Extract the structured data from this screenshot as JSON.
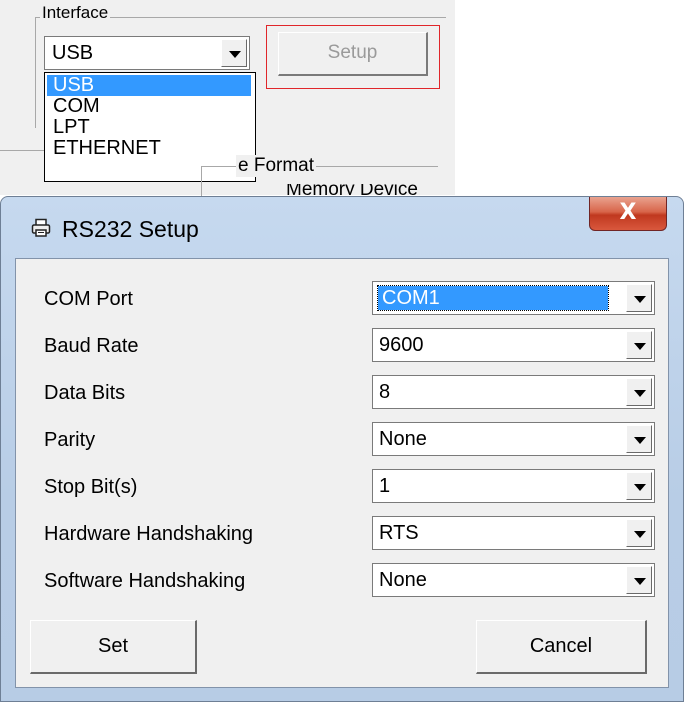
{
  "interface_panel": {
    "legend": "Interface",
    "selected": "USB",
    "options": [
      "USB",
      "COM",
      "LPT",
      "ETHERNET"
    ],
    "highlighted_option": "USB",
    "setup_button": "Setup",
    "format_legend": "e Format",
    "format_sub": "Memory Device",
    "highlight_box_color": "#e0262a"
  },
  "dialog": {
    "title": "RS232 Setup",
    "close_symbol": "X",
    "fields": [
      {
        "label": "COM Port",
        "value": "COM1"
      },
      {
        "label": "Baud Rate",
        "value": "9600"
      },
      {
        "label": "Data Bits",
        "value": "8"
      },
      {
        "label": "Parity",
        "value": "None"
      },
      {
        "label": "Stop Bit(s)",
        "value": "1"
      },
      {
        "label": "Hardware Handshaking",
        "value": "RTS"
      },
      {
        "label": "Software Handshaking",
        "value": "None"
      }
    ],
    "set_button": "Set",
    "cancel_button": "Cancel"
  },
  "icons": {
    "title_icon": "printer-icon",
    "dropdown_icon": "chevron-down-icon"
  }
}
